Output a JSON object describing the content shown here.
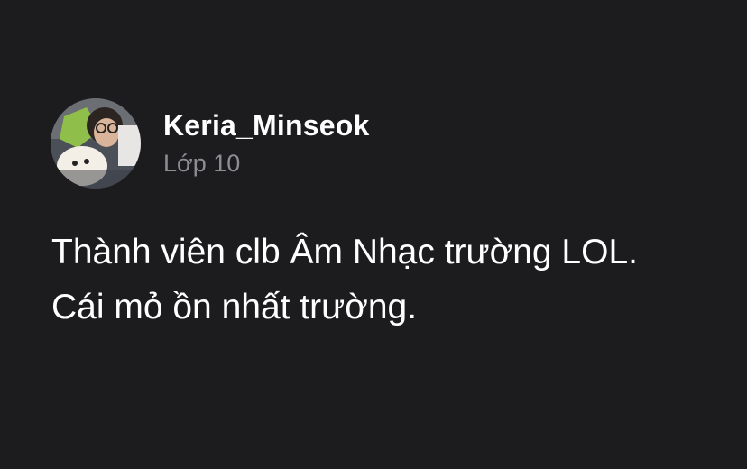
{
  "profile": {
    "username": "Keria_Minseok",
    "subtitle": "Lớp 10",
    "avatar_icon": "profile-photo"
  },
  "bio": {
    "lines": [
      "Thành viên clb Âm Nhạc trường LOL.",
      "Cái mỏ ồn nhất trường."
    ]
  },
  "colors": {
    "background": "#1c1b1d",
    "text_primary": "#ffffff",
    "text_secondary": "#8e8d92"
  }
}
